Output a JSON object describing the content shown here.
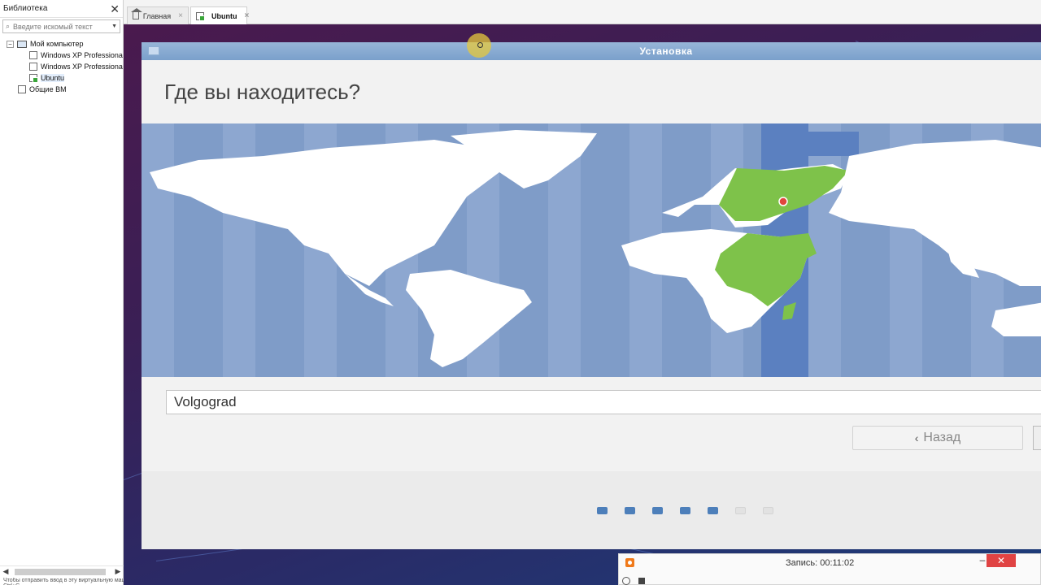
{
  "library": {
    "title": "Библиотека",
    "close_glyph": "✕",
    "search_placeholder": "Введите искомый текст",
    "tree": {
      "my_computer": "Мой компьютер",
      "vm1": "Windows XP Professional",
      "vm2": "Windows XP Professional",
      "vm3": "Ubuntu",
      "shared": "Общие ВМ",
      "toggle_symbol": "−"
    },
    "status_hint": "Чтобы отправить ввод в эту виртуальную машину, щелкните внутри окна или нажмите Ctrl+G."
  },
  "tabs": [
    {
      "label": "Главная",
      "close": "×"
    },
    {
      "label": "Ubuntu",
      "close": "×"
    }
  ],
  "installer": {
    "window_title": "Установка",
    "heading": "Где вы находитесь?",
    "timezone_value": "Volgograd",
    "back_label": "Назад",
    "back_chevron": "‹",
    "progress": {
      "total": 7,
      "completed": 5
    }
  },
  "map": {
    "highlight_timezone": "Europe/Volgograd",
    "ocean_color": "#7f9cc8",
    "land_color": "#ffffff",
    "highlight_color": "#7ec24a",
    "marker_color": "#e0463c"
  },
  "recorder": {
    "title": "Запись:  00:11:02",
    "min_glyph": "–",
    "close_glyph": "✕"
  },
  "colors": {
    "title_bar": "#7aa0cb",
    "progress_dot": "#4d7fba",
    "close_red": "#e04343",
    "desktop_purple": "#3a1f55"
  }
}
